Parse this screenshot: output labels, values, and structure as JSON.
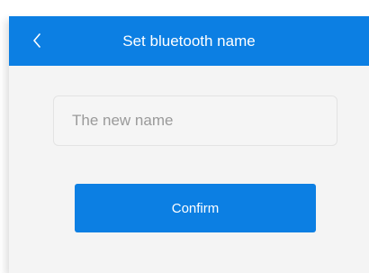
{
  "header": {
    "title": "Set bluetooth name",
    "back_icon": "chevron-left-icon"
  },
  "form": {
    "name_input": {
      "value": "",
      "placeholder": "The new name"
    },
    "confirm_label": "Confirm"
  },
  "colors": {
    "accent": "#0c7fe3",
    "background": "#f4f4f4",
    "input_border": "#e3e3e3"
  }
}
